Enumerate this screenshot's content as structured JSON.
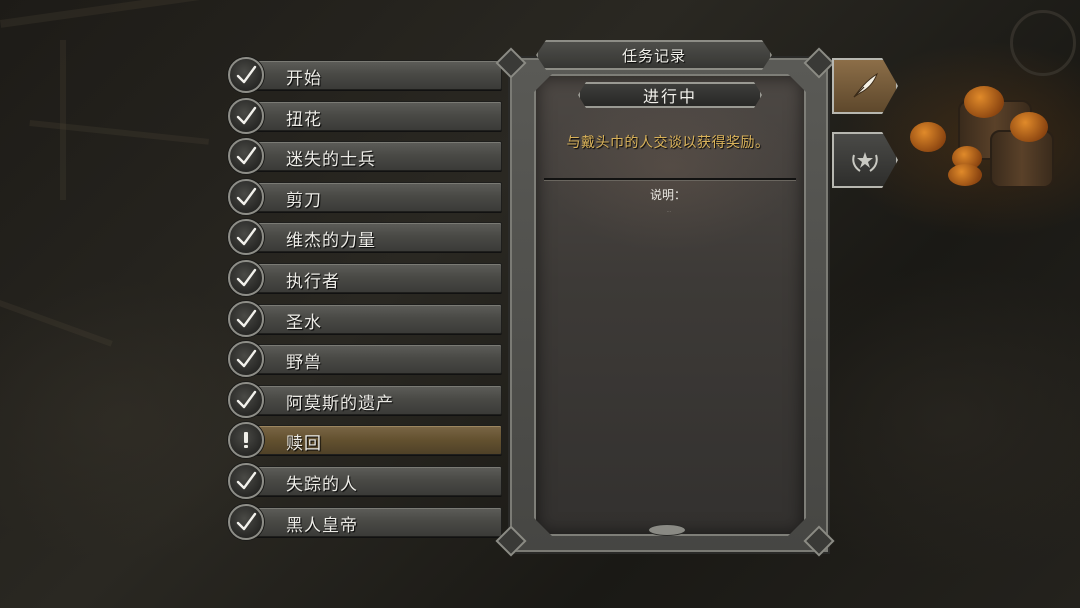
{
  "panel": {
    "title": "任务记录",
    "status": "进行中",
    "objective": "与戴头巾的人交谈以获得奖励。",
    "description_label": "说明：",
    "description_text": "..."
  },
  "quests": [
    {
      "label": "开始",
      "state": "completed"
    },
    {
      "label": "扭花",
      "state": "completed"
    },
    {
      "label": "迷失的士兵",
      "state": "completed"
    },
    {
      "label": "剪刀",
      "state": "completed"
    },
    {
      "label": "维杰的力量",
      "state": "completed"
    },
    {
      "label": "执行者",
      "state": "completed"
    },
    {
      "label": "圣水",
      "state": "completed"
    },
    {
      "label": "野兽",
      "state": "completed"
    },
    {
      "label": "阿莫斯的遗产",
      "state": "completed"
    },
    {
      "label": "赎回",
      "state": "active"
    },
    {
      "label": "失踪的人",
      "state": "completed"
    },
    {
      "label": "黑人皇帝",
      "state": "completed"
    }
  ],
  "side_tabs": [
    {
      "icon": "quill-icon",
      "selected": true
    },
    {
      "icon": "star-laurel-icon",
      "selected": false
    }
  ],
  "colors": {
    "objective_text": "#d9b25a",
    "active_row": "#63512f",
    "selected_tab": "#8c6e48"
  }
}
